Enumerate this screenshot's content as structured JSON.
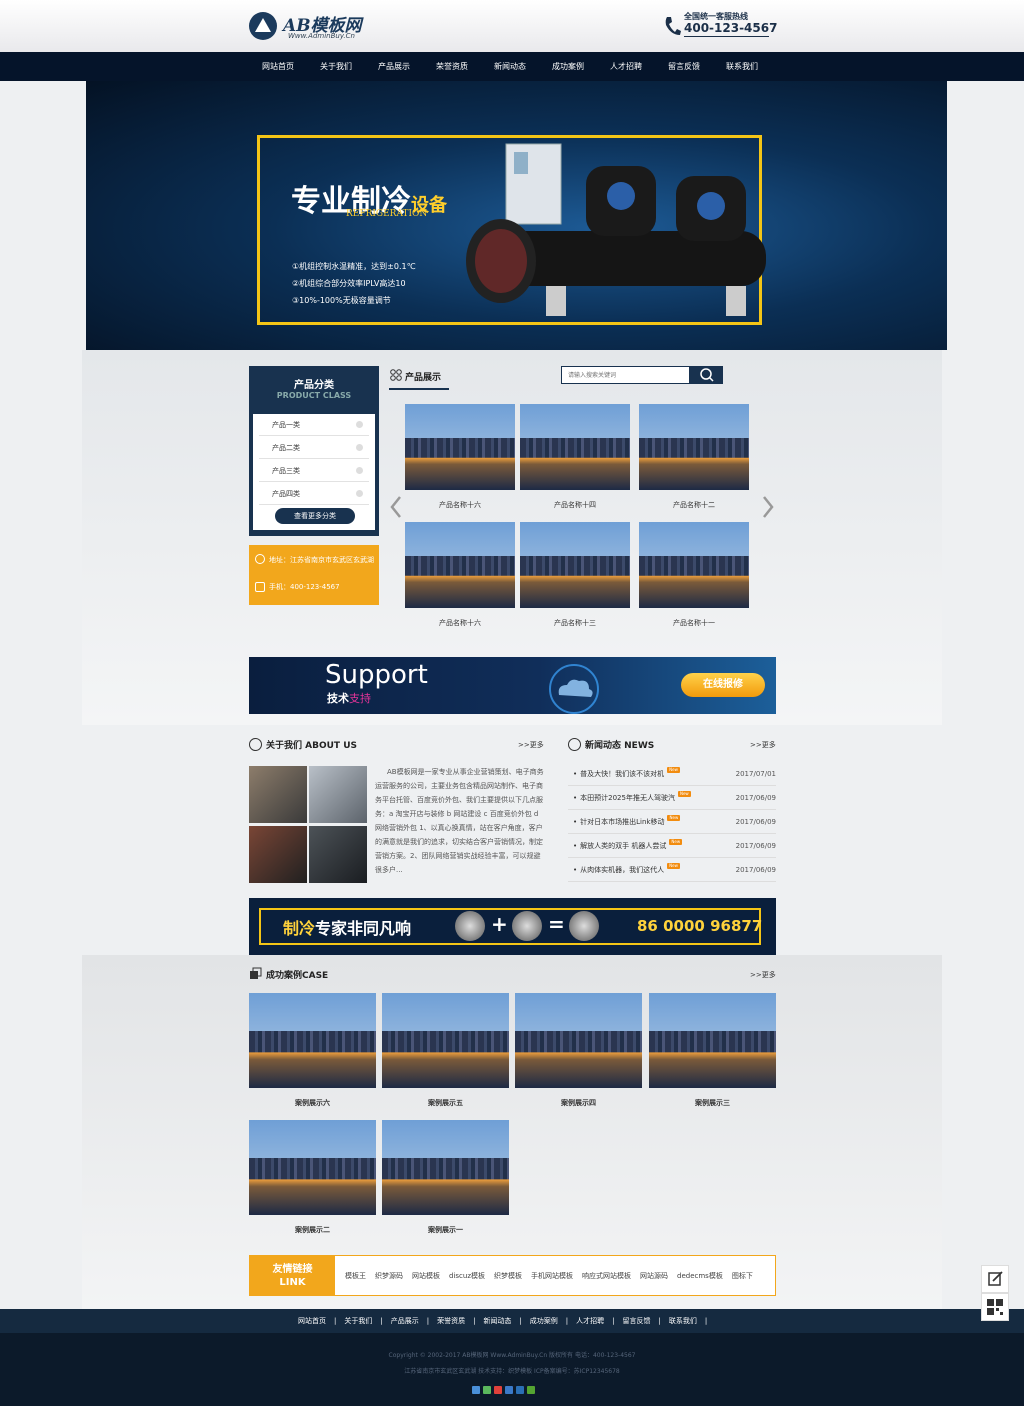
{
  "header": {
    "logo_text": "AB模板网",
    "logo_sub": "Www.AdminBuy.Cn",
    "hotline_label": "全国统一客服热线",
    "hotline_number": "400-123-4567"
  },
  "nav": [
    "网站首页",
    "关于我们",
    "产品展示",
    "荣誉资质",
    "新闻动态",
    "成功案例",
    "人才招聘",
    "留言反馈",
    "联系我们"
  ],
  "banner": {
    "title_main": "专业制冷",
    "title_sub": "设备",
    "title_en": "REFRIGERATION",
    "points": [
      "①机组控制水温精准，达到±0.1℃",
      "②机组综合部分效率IPLV高达10",
      "③10%-100%无极容量调节"
    ]
  },
  "product_class": {
    "title": "产品分类",
    "title_en": "PRODUCT CLASS",
    "items": [
      "产品一类",
      "产品二类",
      "产品三类",
      "产品四类"
    ],
    "more": "查看更多分类"
  },
  "contact": {
    "address": "地址：江苏省南京市玄武区玄武湖",
    "phone": "手机：400-123-4567"
  },
  "products": {
    "title": "产品展示",
    "search_placeholder": "请输入搜索关键词",
    "items": [
      "产品名称十六",
      "产品名称十四",
      "产品名称十二",
      "产品名称十六",
      "产品名称十三",
      "产品名称十一"
    ]
  },
  "support": {
    "title_en": "Support",
    "title_cn_a": "技术",
    "title_cn_b": "支持",
    "button": "在线报修"
  },
  "about": {
    "title": "关于我们 ABOUT US",
    "more": ">>更多",
    "text": "AB模板网是一家专业从事企业营销策划、电子商务运营服务的公司，主要业务包含精品网站制作、电子商务平台托管、百度竞价外包、我们主要提供以下几点服务：a 淘宝开店与装修 b 网站建设 c 百度竞价外包 d 网络营销外包 1、以真心换真情，站在客户角度，客户的满意就是我们的追求，切实结合客户营销情况，制定营销方案。2、团队网络营销实战经验丰富，可以规避很多户..."
  },
  "news": {
    "title": "新闻动态 NEWS",
    "more": ">>更多",
    "badge": "New",
    "items": [
      {
        "title": "普及大快！我们该不该对机",
        "date": "2017/07/01"
      },
      {
        "title": "本田预计2025年推无人驾驶汽",
        "date": "2017/06/09"
      },
      {
        "title": "针对日本市场推出Link移动",
        "date": "2017/06/09"
      },
      {
        "title": "解放人类的双手 机器人尝试",
        "date": "2017/06/09"
      },
      {
        "title": "从肉体实机器，我们这代人",
        "date": "2017/06/09"
      }
    ]
  },
  "ad2": {
    "text_a": "制冷",
    "text_b": "专家非同凡响",
    "phone": "86 0000 96877"
  },
  "cases": {
    "title": "成功案例CASE",
    "more": ">>更多",
    "items": [
      "案例展示六",
      "案例展示五",
      "案例展示四",
      "案例展示三",
      "案例展示二",
      "案例展示一"
    ]
  },
  "links": {
    "title": "友情链接",
    "title_en": "LINK",
    "items": [
      "模板王",
      "织梦源码",
      "网站模板",
      "discuz模板",
      "织梦模板",
      "手机网站模板",
      "响应式网站模板",
      "网站源码",
      "dedecms模板",
      "图标下"
    ]
  },
  "footer": {
    "nav": [
      "网站首页",
      "关于我们",
      "产品展示",
      "荣誉资质",
      "新闻动态",
      "成功案例",
      "人才招聘",
      "留言反馈",
      "联系我们"
    ],
    "copyright": "Copyright © 2002-2017 AB模板网 Www.AdminBuy.Cn 版权所有    电话：400-123-4567",
    "icp": "江苏省南京市玄武区玄武湖    技术支持：织梦模板    ICP备案编号：苏ICP12345678"
  },
  "colors": {
    "navy": "#05142a",
    "accent_orange": "#f2a71c",
    "accent_yellow": "#f4c516"
  }
}
